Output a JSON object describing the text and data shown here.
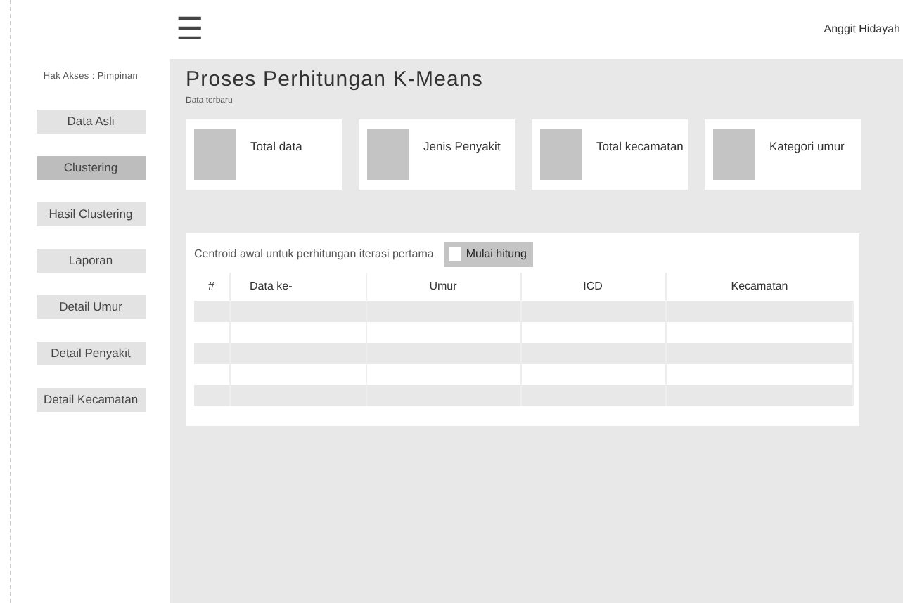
{
  "topbar": {
    "menu_icon": "☰",
    "user": "Anggit Hidayah"
  },
  "sidebar": {
    "access_label": "Hak Akses : Pimpinan",
    "items": [
      {
        "label": "Data Asli",
        "selected": false
      },
      {
        "label": "Clustering",
        "selected": true
      },
      {
        "label": "Hasil Clustering",
        "selected": false
      },
      {
        "label": "Laporan",
        "selected": false
      },
      {
        "label": "Detail Umur",
        "selected": false
      },
      {
        "label": "Detail Penyakit",
        "selected": false
      },
      {
        "label": "Detail Kecamatan",
        "selected": false
      }
    ]
  },
  "page": {
    "title": "Proses Perhitungan K-Means",
    "subtitle": "Data terbaru"
  },
  "stat_cards": [
    {
      "label": "Total data"
    },
    {
      "label": "Jenis Penyakit"
    },
    {
      "label": "Total kecamatan"
    },
    {
      "label": "Kategori umur"
    }
  ],
  "centroid": {
    "caption": "Centroid awal untuk perhitungan iterasi pertama",
    "button": "Mulai hitung",
    "table": {
      "columns": [
        "#",
        "Data ke-",
        "Umur",
        "ICD",
        "Kecamatan"
      ]
    }
  }
}
